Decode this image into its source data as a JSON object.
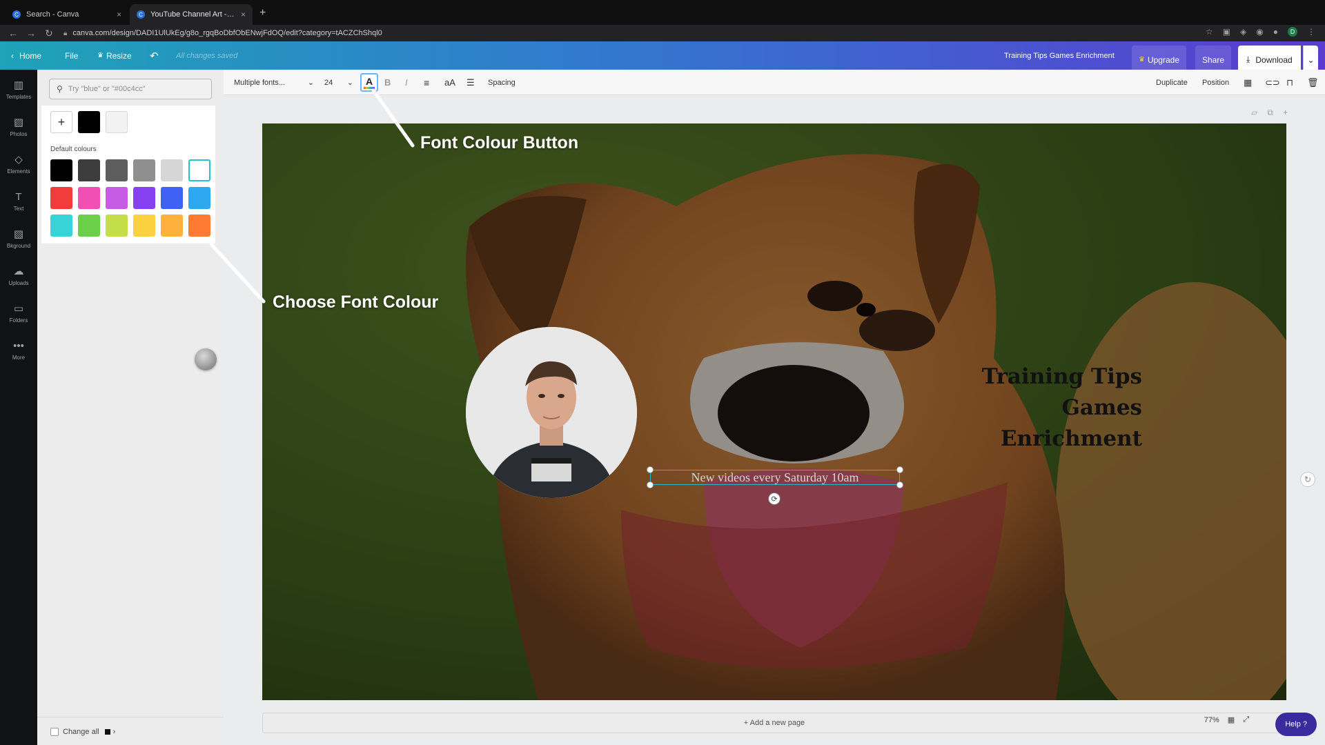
{
  "browser": {
    "tabs": [
      {
        "title": "Search - Canva",
        "active": false
      },
      {
        "title": "YouTube Channel Art - Training Tips Games Enrichment",
        "active": true
      }
    ],
    "new_tab": "+",
    "url": "canva.com/design/DADI1UlUkEg/g8o_rgqBoDbfObENwjFdOQ/edit?category=tACZChShql0",
    "profile_initial": "D"
  },
  "header": {
    "home": "Home",
    "file": "File",
    "resize": "Resize",
    "saved_status": "All changes saved",
    "design_title": "Training Tips Games Enrichment",
    "upgrade": "Upgrade",
    "share": "Share",
    "download": "Download",
    "gradient": [
      "#1ea3b7",
      "#3279cf",
      "#5a3bd0"
    ]
  },
  "sidenav": [
    {
      "label": "Templates",
      "icon": "templates-icon",
      "glyph": "▥"
    },
    {
      "label": "Photos",
      "icon": "photos-icon",
      "glyph": "▨"
    },
    {
      "label": "Elements",
      "icon": "elements-icon",
      "glyph": "◇"
    },
    {
      "label": "Text",
      "icon": "text-icon",
      "glyph": "T"
    },
    {
      "label": "Bkground",
      "icon": "background-icon",
      "glyph": "▧"
    },
    {
      "label": "Uploads",
      "icon": "uploads-icon",
      "glyph": "☁"
    },
    {
      "label": "Folders",
      "icon": "folders-icon",
      "glyph": "▭"
    },
    {
      "label": "More",
      "icon": "more-icon",
      "glyph": "•••"
    }
  ],
  "color_panel": {
    "search_placeholder": "Try \"blue\" or \"#00c4cc\"",
    "document_colors": [
      "#000000",
      "#f2f2f2"
    ],
    "default_title": "Default colours",
    "default_colors": [
      "#000000",
      "#3d3d3d",
      "#5e5e5e",
      "#8f8f8f",
      "#d6d6d6",
      "#ffffff",
      "#f23b3b",
      "#f24fb4",
      "#c75be6",
      "#8642f0",
      "#3f62f5",
      "#2ea8f0",
      "#38d3d6",
      "#6ccf4a",
      "#c4de4a",
      "#fcd141",
      "#ffb13d",
      "#ff7b33"
    ],
    "selected_index": 5,
    "change_all": "Change all"
  },
  "toolbar": {
    "font_family": "Multiple fonts...",
    "font_size": "24",
    "bold": "B",
    "italic": "I",
    "case": "aA",
    "spacing": "Spacing",
    "duplicate": "Duplicate",
    "position": "Position"
  },
  "canvas": {
    "title_lines": [
      "Training Tips",
      "Games",
      "Enrichment"
    ],
    "tagline": "New videos every Saturday 10am",
    "add_page": "+ Add a new page",
    "zoom": "77%",
    "help": "Help ?"
  },
  "annotations": {
    "font_colour_button": "Font Colour Button",
    "choose_font_colour": "Choose Font Colour"
  }
}
